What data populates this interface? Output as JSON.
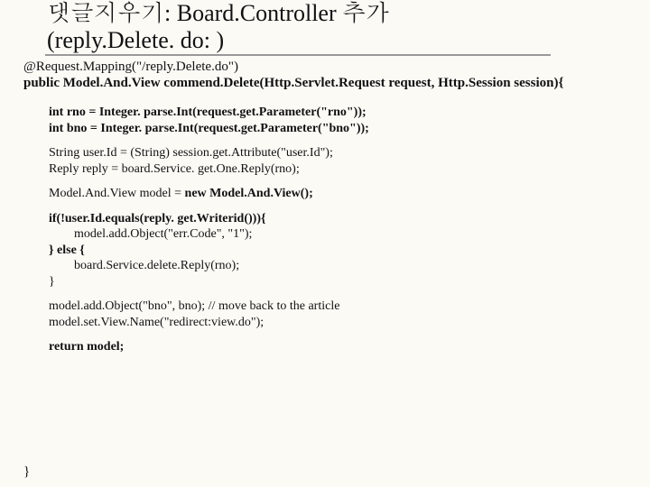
{
  "title": {
    "line1": "댓글지우기: Board.Controller 추가",
    "line2": "(reply.Delete. do: )"
  },
  "annotation": "@Request.Mapping(\"/reply.Delete.do\")",
  "signature": "public Model.And.View commend.Delete(Http.Servlet.Request request, Http.Session session){",
  "code": {
    "l1": "int rno = Integer. parse.Int(request.get.Parameter(\"rno\"));",
    "l2": "int bno = Integer. parse.Int(request.get.Parameter(\"bno\"));",
    "l3": "String user.Id = (String) session.get.Attribute(\"user.Id\");",
    "l4": "Reply reply = board.Service. get.One.Reply(rno);",
    "l5a": "Model.And.View model = ",
    "l5b": "new Model.And.View();",
    "l6": "if(!user.Id.equals(reply. get.Writerid())){",
    "l7": "        model.add.Object(\"err.Code\", \"1\");",
    "l8": "} else {",
    "l9": "        board.Service.delete.Reply(rno);",
    "l10": "}",
    "l11": "model.add.Object(\"bno\", bno); // move back to the article",
    "l12": "model.set.View.Name(\"redirect:view.do\");",
    "l13": "return model;"
  },
  "close": "}"
}
